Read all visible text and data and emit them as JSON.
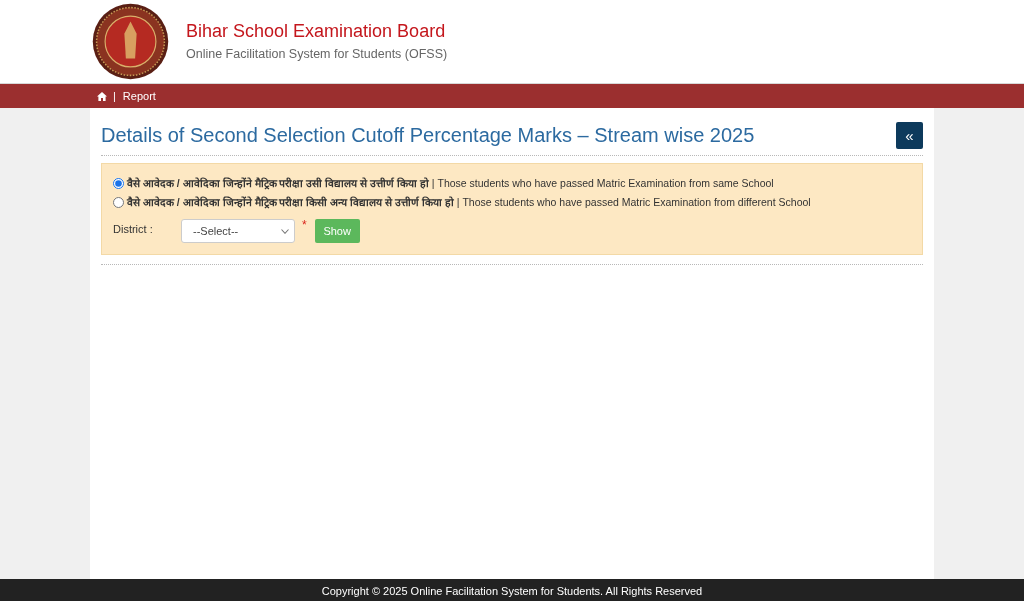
{
  "header": {
    "title": "Bihar School Examination Board",
    "subtitle": "Online Facilitation System for Students (OFSS)"
  },
  "nav": {
    "separator": "|",
    "items": [
      "Report"
    ]
  },
  "page": {
    "heading": "Details of Second Selection Cutoff Percentage Marks – Stream wise 2025",
    "back_button": "«"
  },
  "options": [
    {
      "label": "**वैसे आवेदक / आवेदिका जिन्होंने मैट्रिक परीक्षा उसी विद्यालय से उत्तीर्ण किया हो** | Those students who have passed Matric Examination from same School",
      "selected": true
    },
    {
      "label": "**वैसे आवेदक / आवेदिका जिन्होंने मैट्रिक परीक्षा किसी अन्य विद्यालय से उत्तीर्ण किया हो** | Those students who have passed Matric Examination from different School",
      "selected": false
    }
  ],
  "district": {
    "label": "District :",
    "value": "--Select--",
    "required_mark": "*"
  },
  "show_button": "Show",
  "footer": "Copyright © 2025 Online Facilitation System for Students. All Rights Reserved"
}
